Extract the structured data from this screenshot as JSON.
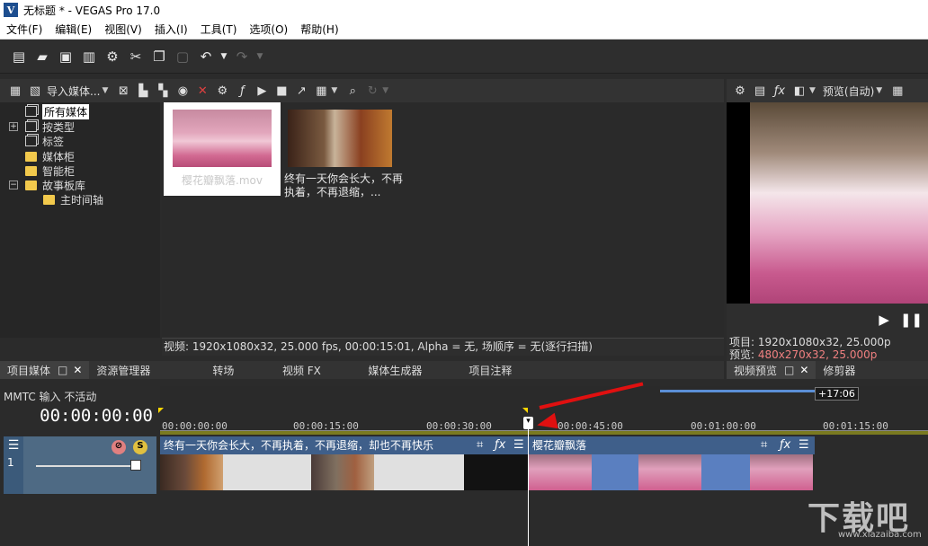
{
  "window": {
    "app_letter": "V",
    "title": "无标题 * - VEGAS Pro 17.0"
  },
  "menu": [
    "文件(F)",
    "编辑(E)",
    "视图(V)",
    "插入(I)",
    "工具(T)",
    "选项(O)",
    "帮助(H)"
  ],
  "media_panel": {
    "import_label": "导入媒体...",
    "tree": {
      "all_media": "所有媒体",
      "by_type": "按类型",
      "tags": "标签",
      "media_bin": "媒体柜",
      "smart_bin": "智能柜",
      "storyboard": "故事板库",
      "main_timeline": "主时间轴"
    },
    "thumb1_caption": "樱花瓣飘落.mov",
    "thumb2_caption": "终有一天你会长大，不再执着，不再退缩，...",
    "info": "视频: 1920x1080x32, 25.000 fps, 00:00:15:01, Alpha = 无, 场顺序 = 无(逐行扫描)"
  },
  "tabs": {
    "project_media": "项目媒体",
    "explorer": "资源管理器",
    "transitions": "转场",
    "video_fx": "视频 FX",
    "media_generators": "媒体生成器",
    "project_notes": "项目注释"
  },
  "preview": {
    "mode_label": "预览(自动)",
    "project_info": "项目: 1920x1080x32, 25.000p",
    "preview_label": "预览: ",
    "preview_info": "480x270x32, 25.000p",
    "tab_video_preview": "视频预览",
    "tab_trimmer": "修剪器"
  },
  "timeline": {
    "mmtc": "MMTC 输入 不活动",
    "timecode": "00:00:00:00",
    "overview_label": "+17:06",
    "ruler": [
      "00:00:00:00",
      "00:00:15:00",
      "00:00:30:00",
      "00:00:45:00",
      "00:01:00:00",
      "00:01:15:00"
    ],
    "track_number": "1",
    "clip1_title": "终有一天你会长大，不再执着，不再退缩，却也不再快乐",
    "clip2_title": "樱花瓣飘落"
  },
  "watermark": {
    "big": "下载吧",
    "small": "www.xiazaiba.com"
  },
  "colors": {
    "accent_blue": "#3f5f8a",
    "annotation_red": "#e01010",
    "timeline_marker": "#ffd700"
  }
}
